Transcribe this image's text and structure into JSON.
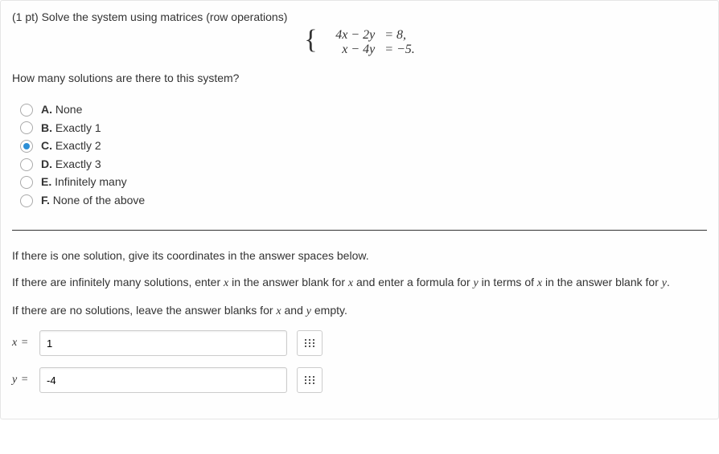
{
  "prompt": "(1 pt) Solve the system using matrices (row operations)",
  "equations": {
    "row1_lhs": "4x − 2y",
    "row1_rhs": "= 8,",
    "row2_lhs": "x − 4y",
    "row2_rhs": "= −5."
  },
  "question": "How many solutions are there to this system?",
  "options": [
    {
      "key": "A.",
      "text": "None",
      "selected": false
    },
    {
      "key": "B.",
      "text": "Exactly 1",
      "selected": false
    },
    {
      "key": "C.",
      "text": "Exactly 2",
      "selected": true
    },
    {
      "key": "D.",
      "text": "Exactly 3",
      "selected": false
    },
    {
      "key": "E.",
      "text": "Infinitely many",
      "selected": false
    },
    {
      "key": "F.",
      "text": "None of the above",
      "selected": false
    }
  ],
  "instructions": {
    "one": "If there is one solution, give its coordinates in the answer spaces below.",
    "inf_pre": "If there are infinitely many solutions, enter ",
    "inf_mid1": " in the answer blank for ",
    "inf_mid2": " and enter a formula for ",
    "inf_mid3": " in terms of ",
    "inf_mid4": " in the answer blank for ",
    "inf_post": ".",
    "none_pre": "If there are no solutions, leave the answer blanks for ",
    "none_and": " and ",
    "none_post": " empty."
  },
  "vars": {
    "x": "x",
    "y": "y"
  },
  "answers": {
    "x_label": "x",
    "x_eq": " =",
    "x_value": "1",
    "y_label": "y",
    "y_eq": " =",
    "y_value": "-4"
  }
}
